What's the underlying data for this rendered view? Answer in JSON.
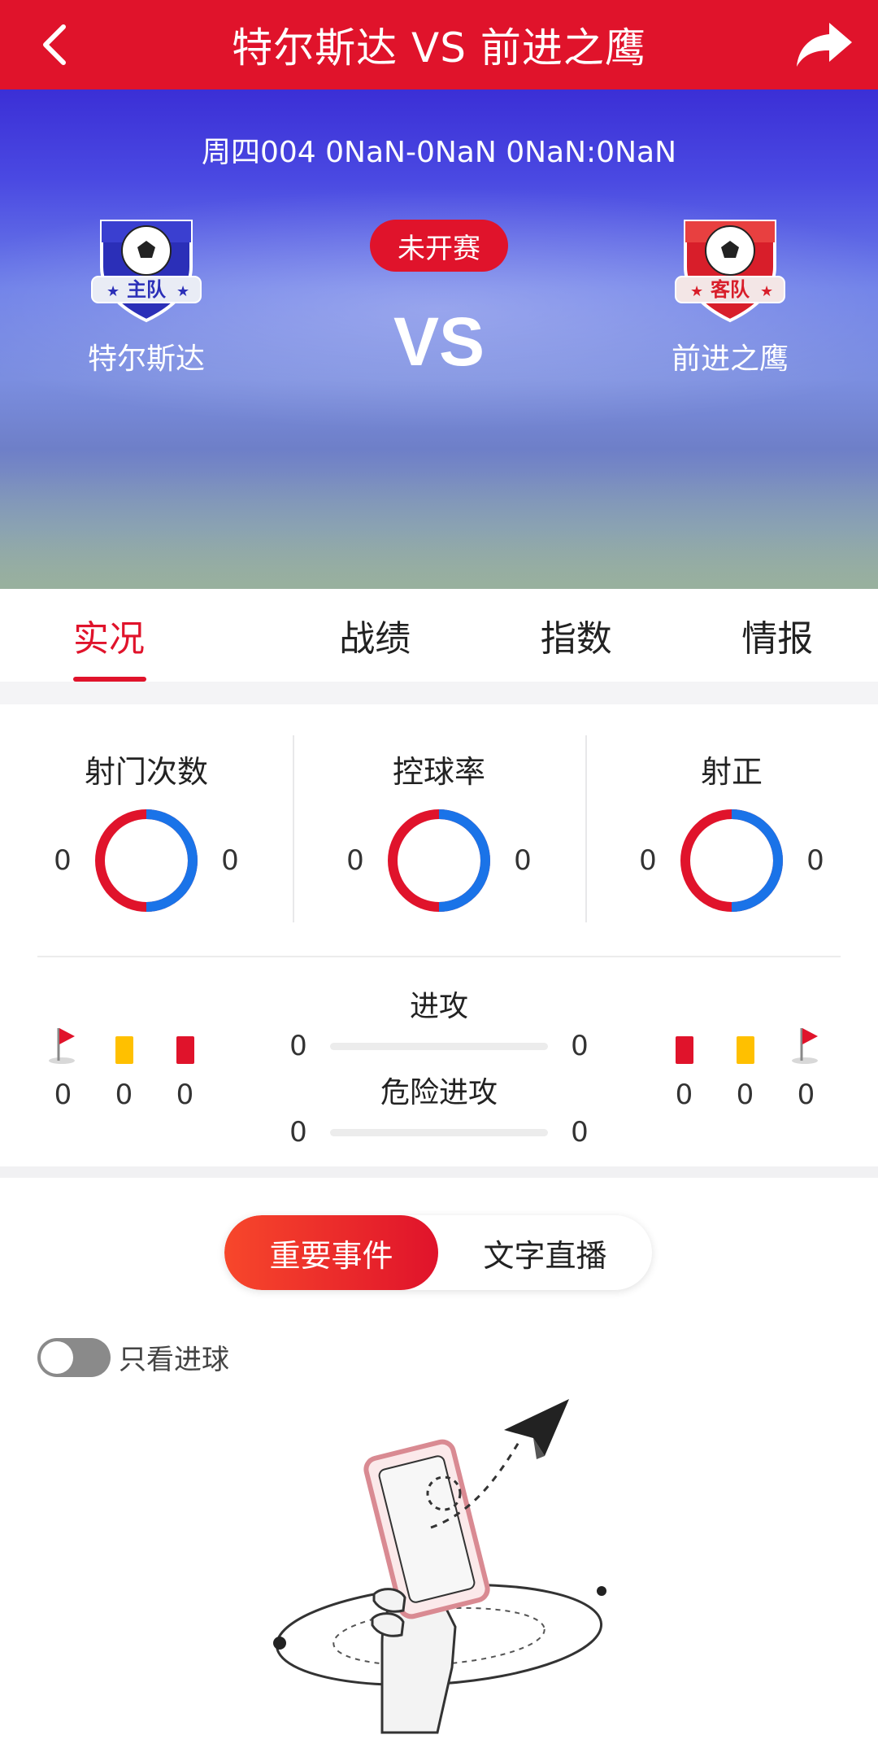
{
  "header": {
    "title": "特尔斯达 VS 前进之鹰",
    "back_icon": "chevron-left-icon",
    "share_icon": "share-arrow-icon"
  },
  "match": {
    "info": "周四004 0NaN-0NaN 0NaN:0NaN",
    "status": "未开赛",
    "vs": "VS",
    "home": {
      "name": "特尔斯达",
      "badge_text": "主队",
      "badge_color": "#2b2fb8"
    },
    "away": {
      "name": "前进之鹰",
      "badge_text": "客队",
      "badge_color": "#d81e2a"
    }
  },
  "tabs": [
    {
      "label": "实况",
      "active": true
    },
    {
      "label": "战绩",
      "active": false
    },
    {
      "label": "指数",
      "active": false
    },
    {
      "label": "情报",
      "active": false
    }
  ],
  "rings": [
    {
      "label": "射门次数",
      "home": "0",
      "away": "0"
    },
    {
      "label": "控球率",
      "home": "0",
      "away": "0"
    },
    {
      "label": "射正",
      "home": "0",
      "away": "0"
    }
  ],
  "attack": {
    "attacks": {
      "label": "进攻",
      "home": "0",
      "away": "0"
    },
    "dangerous": {
      "label": "危险进攻",
      "home": "0",
      "away": "0"
    },
    "home_side": {
      "corners": "0",
      "yellow": "0",
      "red": "0"
    },
    "away_side": {
      "red": "0",
      "yellow": "0",
      "corners": "0"
    }
  },
  "events": {
    "options": [
      "重要事件",
      "文字直播"
    ],
    "selected": "重要事件",
    "only_goals_label": "只看进球",
    "only_goals_on": false
  },
  "colors": {
    "primary_red": "#e0132b",
    "home_blue": "#1a73e8",
    "card_yellow": "#ffc000"
  }
}
